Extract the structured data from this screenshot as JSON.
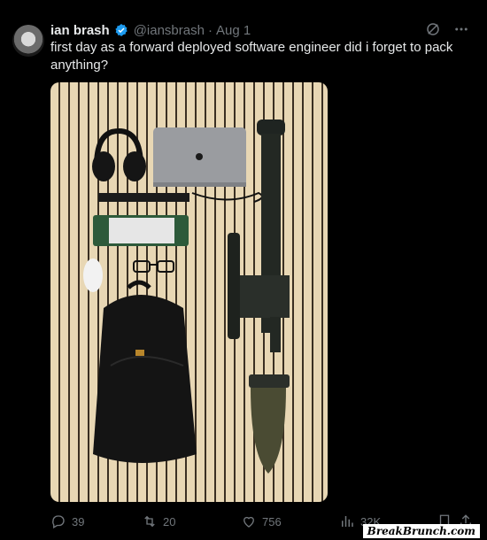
{
  "tweet": {
    "author_name": "ian brash",
    "handle": "@iansbrash",
    "separator": "·",
    "date": "Aug 1",
    "text": "first day as a forward deployed software engineer did i forget to pack anything?"
  },
  "stats": {
    "replies": "39",
    "retweets": "20",
    "likes": "756",
    "views": "32K"
  },
  "icons": {
    "verified": "verified-badge-icon",
    "grok": "grok-icon",
    "more": "more-icon",
    "reply": "reply-icon",
    "retweet": "retweet-icon",
    "like": "heart-icon",
    "views": "views-icon",
    "bookmark": "bookmark-icon",
    "share": "share-icon"
  },
  "colors": {
    "verified": "#1d9bf0",
    "muted": "#71767b",
    "text": "#e7e9ea",
    "background": "#000000"
  },
  "watermark": "BreakBrunch.com"
}
